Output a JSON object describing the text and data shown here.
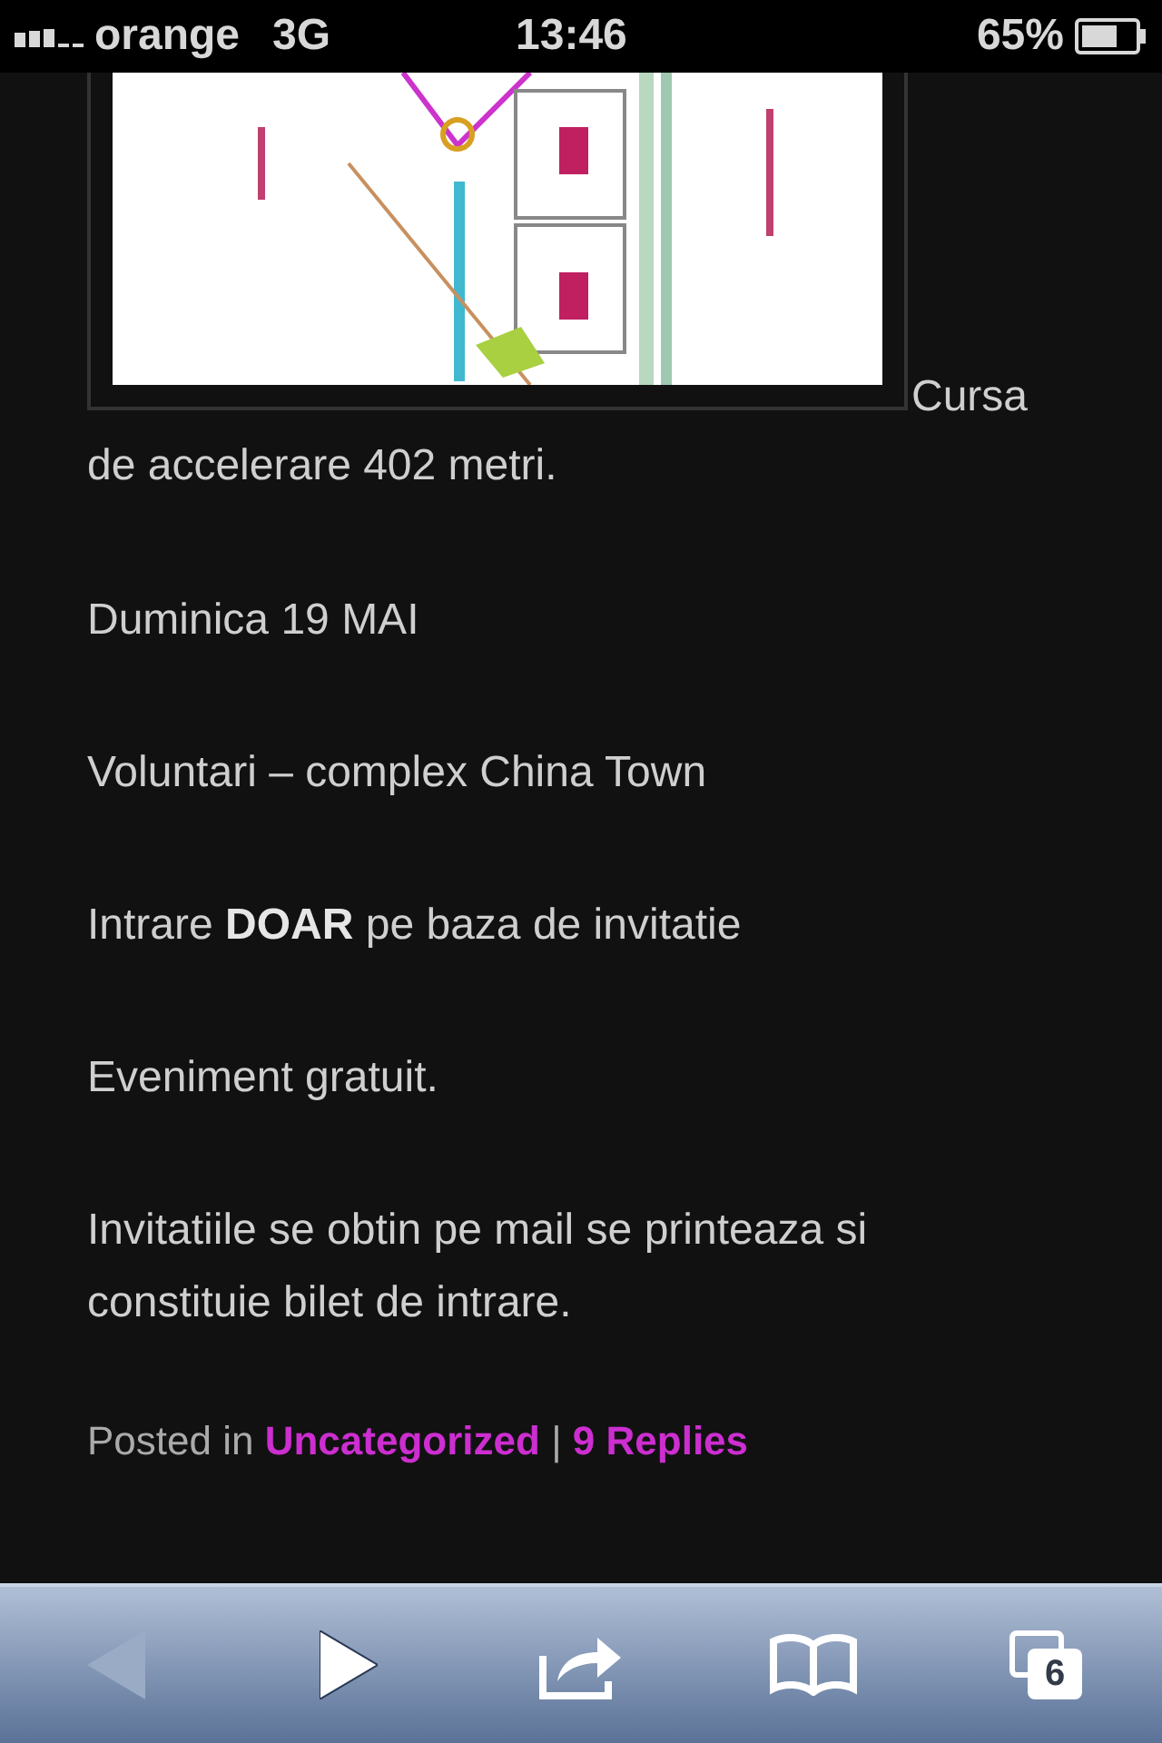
{
  "status_bar": {
    "carrier": "orange",
    "network": "3G",
    "time": "13:46",
    "battery": "65%"
  },
  "article": {
    "paragraphs": [
      "Cursa de accelerare 402 metri.",
      "Duminica 19 MAI",
      "Voluntari – complex China Town",
      "Intrare **DOAR** pe baza de invitatie",
      "Eveniment gratuit.",
      "Invitatiile se obtin pe mail se printeaza si constituie bilet de intrare."
    ],
    "meta": {
      "prefix": "Posted in",
      "category": "Uncategorized",
      "separator": "|",
      "replies": "9 Replies"
    }
  },
  "toolbar": [
    {
      "kind": "back",
      "disabled": true
    },
    {
      "kind": "forward",
      "disabled": false
    },
    {
      "kind": "share",
      "disabled": false
    },
    {
      "kind": "bookmarks",
      "disabled": false
    },
    {
      "kind": "tabs",
      "disabled": false,
      "count": "6"
    }
  ]
}
